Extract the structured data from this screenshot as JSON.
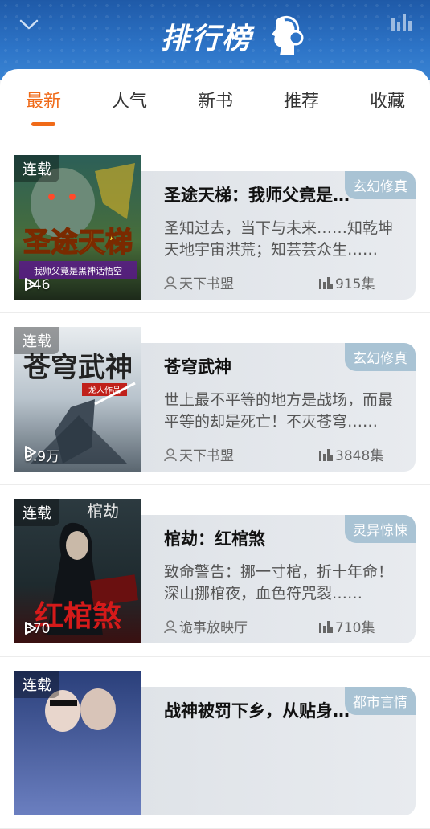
{
  "header": {
    "title": "排行榜",
    "back_icon": "chevron-down-icon",
    "stats_icon": "bar-chart-icon"
  },
  "tabs": [
    {
      "label": "最新",
      "active": true
    },
    {
      "label": "人气",
      "active": false
    },
    {
      "label": "新书",
      "active": false
    },
    {
      "label": "推荐",
      "active": false
    },
    {
      "label": "收藏",
      "active": false
    }
  ],
  "colors": {
    "accent": "#f06a18",
    "header": "#2d74c7",
    "genre_tag": "#a9c3d4"
  },
  "books": [
    {
      "status": "连载",
      "plays": "346",
      "genre": "玄幻修真",
      "title": "圣途天梯：我师父竟是黑神话悟空",
      "desc": "圣知过去，当下与未来……知乾坤天地宇宙洪荒；知芸芸众生……",
      "author": "天下书盟",
      "episodes": "915集",
      "cover_text": "圣途天梯",
      "cover_sub": "我师父竟是黑神话悟空"
    },
    {
      "status": "连载",
      "plays": "9.9万",
      "genre": "玄幻修真",
      "title": "苍穹武神",
      "desc": "世上最不平等的地方是战场，而最平等的却是死亡！不灭苍穹……",
      "author": "天下书盟",
      "episodes": "3848集",
      "cover_text": "苍穹武神",
      "cover_sub": "龙人作品"
    },
    {
      "status": "连载",
      "plays": "870",
      "genre": "灵异惊悚",
      "title": "棺劫：红棺煞",
      "desc": "致命警告：挪一寸棺，折十年命！深山挪棺夜，血色符咒裂……",
      "author": "诡事放映厅",
      "episodes": "710集",
      "cover_text": "红棺煞",
      "cover_sub": "棺劫"
    },
    {
      "status": "连载",
      "plays": "",
      "genre": "都市言情",
      "title": "战神被罚下乡，从贴身……",
      "desc": "",
      "author": "",
      "episodes": "",
      "cover_text": "",
      "cover_sub": ""
    }
  ]
}
